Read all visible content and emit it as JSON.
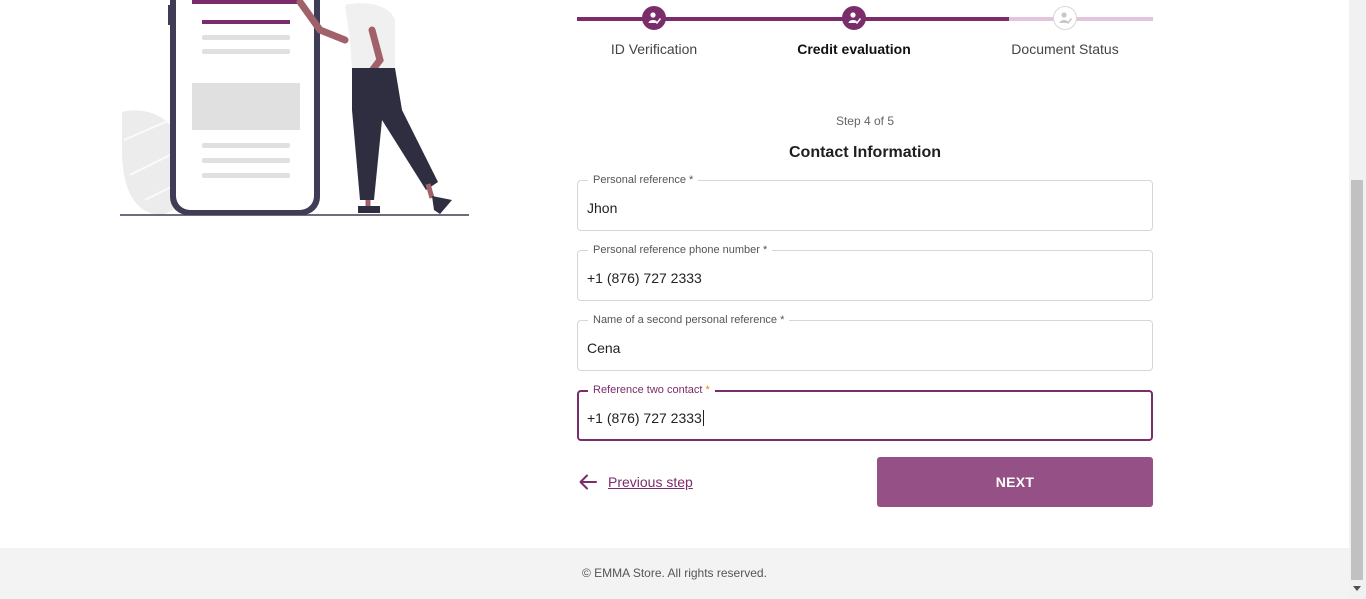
{
  "stepper": {
    "steps": [
      {
        "label": "ID Verification",
        "state": "complete"
      },
      {
        "label": "Credit evaluation",
        "state": "current"
      },
      {
        "label": "Document Status",
        "state": "pending"
      }
    ]
  },
  "form": {
    "step_counter": "Step 4 of 5",
    "title": "Contact Information",
    "fields": [
      {
        "label": "Personal reference",
        "required_mark": "*",
        "value": "Jhon"
      },
      {
        "label": "Personal reference phone number",
        "required_mark": "*",
        "value": "+1 (876) 727 2333"
      },
      {
        "label": "Name of a second personal reference",
        "required_mark": "*",
        "value": "Cena"
      },
      {
        "label": "Reference two contact",
        "required_mark": "*",
        "value": "+1 (876) 727 2333"
      }
    ]
  },
  "nav": {
    "previous_label": "Previous step",
    "next_label": "NEXT"
  },
  "footer": {
    "copyright": "© EMMA Store. All rights reserved."
  },
  "colors": {
    "accent": "#7b2c6b",
    "accent_light": "#e2c5dc",
    "button": "#955186",
    "required_focused": "#e08a00"
  }
}
